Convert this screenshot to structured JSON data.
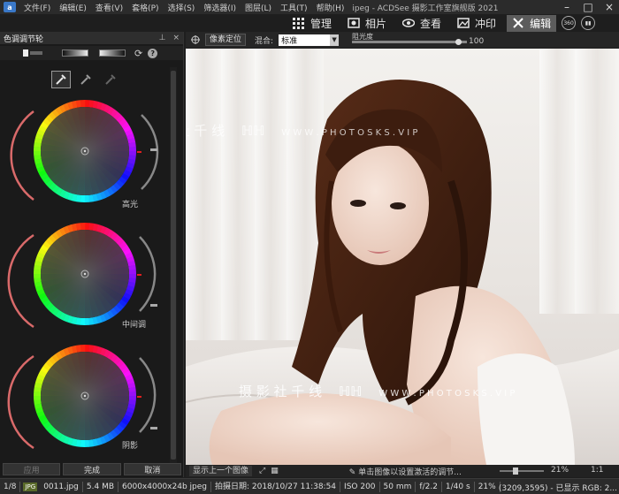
{
  "menu": {
    "items": [
      "文件(F)",
      "编辑(E)",
      "查看(V)",
      "套格(P)",
      "选择(S)",
      "筛选器(I)",
      "图层(L)",
      "工具(T)",
      "帮助(H)"
    ],
    "window_title": "ipeg - ACDSee 摄影工作室旗舰版 2021"
  },
  "modes": [
    {
      "label": "管理",
      "icon": "grid-icon",
      "active": false
    },
    {
      "label": "相片",
      "icon": "photos-icon",
      "active": false
    },
    {
      "label": "查看",
      "icon": "eye-icon",
      "active": false
    },
    {
      "label": "冲印",
      "icon": "develop-icon",
      "active": false
    },
    {
      "label": "编辑",
      "icon": "edit-icon",
      "active": true
    }
  ],
  "panel": {
    "title": "色调调节轮",
    "pin": "ᵖ",
    "close": "×",
    "wheels": [
      {
        "label": "高光"
      },
      {
        "label": "中间调"
      },
      {
        "label": "阴影"
      }
    ],
    "buttons": {
      "apply": "应用",
      "done": "完成",
      "cancel": "取消"
    }
  },
  "image_toolbar": {
    "fit_label": "像素定位",
    "blend_label": "混合:",
    "blend_value": "标准",
    "opacity_label": "阻光度",
    "opacity_value": "100",
    "opacity_fraction": 0.94
  },
  "watermark": {
    "cn": "摄 影 社 千 线",
    "en": "W W W . P H O T O S K S . V I P"
  },
  "img_status": {
    "prev": "显示上一个图像",
    "hint": "单击图像以设置激活的调节...",
    "zoom": "21%",
    "ratio": "1:1"
  },
  "statusbar": {
    "index": "1/8",
    "format": "JPG",
    "filename": "0011.jpg",
    "size": "5.4 MB",
    "dims": "6000x4000x24b jpeg",
    "date": "拍摄日期: 2018/10/27 11:38:54",
    "iso": "ISO 200",
    "focal": "50 mm",
    "aperture": "f/2.2",
    "shutter": "1/40 s",
    "zoom": "21%",
    "coords": "(3209,3595) - 已显示 RGB: 2..."
  }
}
